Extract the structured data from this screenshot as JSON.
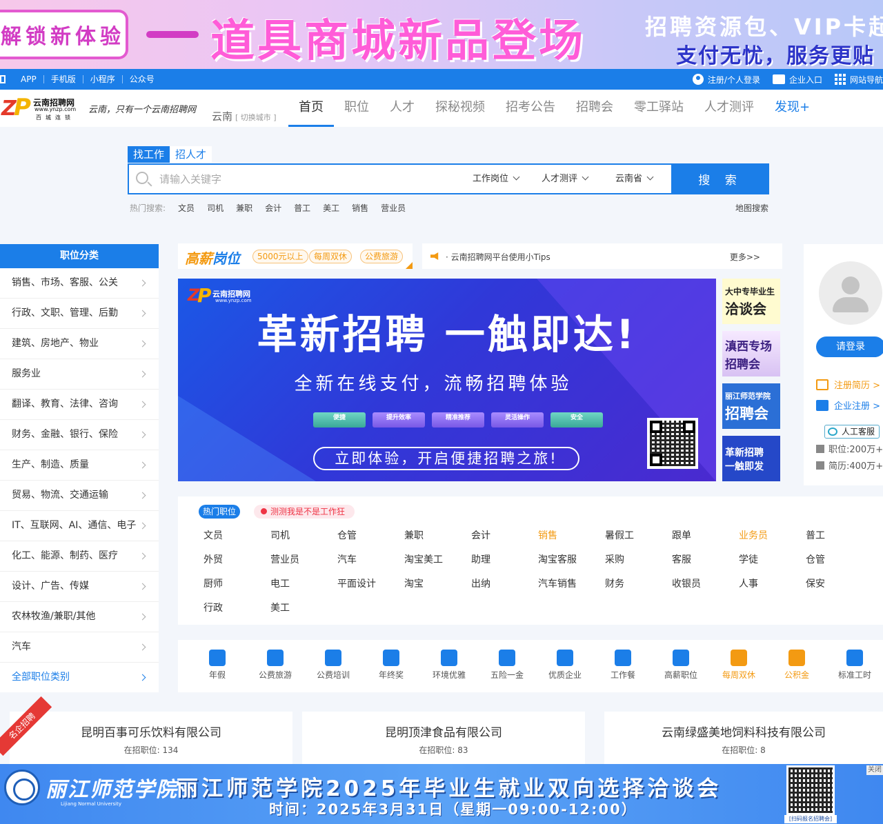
{
  "top_banner": {
    "left": "解锁新体验",
    "main": "道具商城新品登场",
    "right_1": "招聘资源包、VIP卡起",
    "right_2": "支付无忧，服务更贴"
  },
  "topbar": {
    "left_links": [
      "APP",
      "手机版",
      "小程序",
      "公众号"
    ],
    "login": "注册/个人登录",
    "company": "企业入口",
    "sitemap": "网站导航"
  },
  "header": {
    "logo_name": "云南招聘网",
    "logo_url": "www.ynzp.com",
    "logo_tag": "百城连锁",
    "slogan": "云南，只有一个云南招聘网",
    "city": "云南",
    "switch_city": "[ 切换城市 ]",
    "nav": [
      "首页",
      "职位",
      "人才",
      "探秘视频",
      "招考公告",
      "招聘会",
      "零工驿站",
      "人才测评",
      "发现+"
    ]
  },
  "search": {
    "tabs": [
      "找工作",
      "招人才"
    ],
    "placeholder": "请输入关键字",
    "dropdowns": [
      "工作岗位",
      "人才测评",
      "云南省"
    ],
    "button": "搜 索",
    "hot_label": "热门搜索:",
    "hot_words": [
      "文员",
      "司机",
      "兼职",
      "会计",
      "普工",
      "美工",
      "销售",
      "营业员"
    ],
    "map_search": "地图搜索"
  },
  "sidebar": {
    "title": "职位分类",
    "items": [
      "销售、市场、客服、公关",
      "行政、文职、管理、后勤",
      "建筑、房地产、物业",
      "服务业",
      "翻译、教育、法律、咨询",
      "财务、金融、银行、保险",
      "生产、制造、质量",
      "贸易、物流、交通运输",
      "IT、互联网、AI、通信、电子",
      "化工、能源、制药、医疗",
      "设计、广告、传媒",
      "农林牧渔/兼职/其他",
      "汽车"
    ],
    "all": "全部职位类别"
  },
  "high_salary": {
    "logo_a": "高薪",
    "logo_b": "岗位",
    "tags": [
      "5000元以上",
      "每周双休",
      "公费旅游"
    ]
  },
  "notice": {
    "text": "· 云南招聘网平台使用小Tips",
    "more": "更多>>"
  },
  "main_banner": {
    "logo_name": "云南招聘网",
    "logo_url": "www.ynzp.com",
    "title": "革新招聘 一触即达!",
    "subtitle": "全新在线支付，流畅招聘体验",
    "features": [
      "便捷",
      "提升效率",
      "精准推荐",
      "灵活操作",
      "安全"
    ],
    "cta": "立即体验，开启便捷招聘之旅!"
  },
  "side_promos": [
    {
      "line1": "大中专毕业生",
      "line2": "洽谈会"
    },
    {
      "line1": "滇西专场",
      "line2": "招聘会"
    },
    {
      "line1": "丽江师范学院",
      "line2": "招聘会"
    },
    {
      "line1": "革新招聘",
      "line2": "一触即发"
    }
  ],
  "user_panel": {
    "login": "请登录",
    "register_resume": "注册简历 >",
    "company_register": "企业注册 >",
    "service": "人工客服",
    "jobs_stat": "职位:200万+",
    "resume_stat": "简历:400万+"
  },
  "hot_jobs": {
    "tag": "热门职位",
    "test": "测测我是不是工作狂",
    "rows": [
      [
        "文员",
        "司机",
        "仓管",
        "兼职",
        "会计",
        "销售",
        "暑假工",
        "跟单",
        "业务员",
        "普工"
      ],
      [
        "外贸",
        "营业员",
        "汽车",
        "淘宝美工",
        "助理",
        "淘宝客服",
        "采购",
        "客服",
        "学徒",
        "仓管"
      ],
      [
        "厨师",
        "电工",
        "平面设计",
        "淘宝",
        "出纳",
        "汽车销售",
        "财务",
        "收银员",
        "人事",
        "保安"
      ],
      [
        "行政",
        "美工"
      ]
    ],
    "highlight": [
      "销售",
      "业务员"
    ]
  },
  "benefits": [
    "年假",
    "公费旅游",
    "公费培训",
    "年终奖",
    "环境优雅",
    "五险一金",
    "优质企业",
    "工作餐",
    "高薪职位",
    "每周双休",
    "公积金",
    "标准工时"
  ],
  "benefits_highlight": [
    "每周双休",
    "公积金"
  ],
  "companies": [
    {
      "name": "昆明百事可乐饮料有限公司",
      "count_label": "在招职位: 134"
    },
    {
      "name": "昆明顶津食品有限公司",
      "count_label": "在招职位: 83"
    },
    {
      "name": "云南绿盛美地饲料科技有限公司",
      "count_label": "在招职位: 8"
    }
  ],
  "famous_ribbon": "名企招聘",
  "bottom_banner": {
    "school": "丽江师范学院",
    "school_en": "Lijiang Normal University",
    "title": "丽江师范学院2025年毕业生就业双向选择洽谈会",
    "time": "时间：2025年3月31日（星期一09:00-12:00）",
    "qr_label": "[扫码报名招聘会]",
    "close": "关闭"
  },
  "colors": {
    "brand": "#1b7ee8",
    "accent": "#f39a12",
    "pink": "#ff5cd8"
  }
}
